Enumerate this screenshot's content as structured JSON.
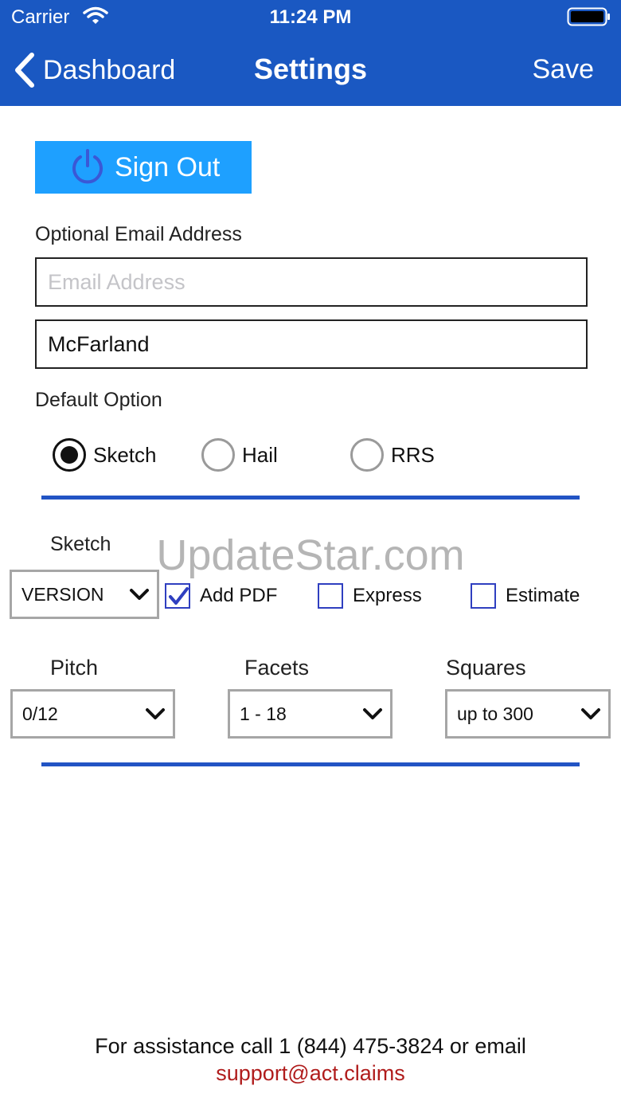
{
  "status_bar": {
    "carrier": "Carrier",
    "time": "11:24 PM"
  },
  "nav": {
    "back_label": "Dashboard",
    "title": "Settings",
    "save_label": "Save"
  },
  "sign_out": {
    "label": "Sign Out",
    "icon": "power-icon"
  },
  "email": {
    "label": "Optional Email Address",
    "placeholder": "Email Address",
    "value": ""
  },
  "name_field": {
    "value": "McFarland"
  },
  "default_option": {
    "label": "Default Option",
    "options": [
      "Sketch",
      "Hail",
      "RRS"
    ],
    "selected": "Sketch"
  },
  "sketch": {
    "label": "Sketch",
    "version_value": "VERSION",
    "checkboxes": [
      {
        "label": "Add PDF",
        "checked": true
      },
      {
        "label": "Express",
        "checked": false
      },
      {
        "label": "Estimate",
        "checked": false
      }
    ]
  },
  "dropdowns": {
    "pitch": {
      "label": "Pitch",
      "value": "0/12"
    },
    "facets": {
      "label": "Facets",
      "value": "1 - 18"
    },
    "squares": {
      "label": "Squares",
      "value": "up to 300"
    }
  },
  "watermark": "UpdateStar.com",
  "footer": {
    "text": "For assistance call 1 (844) 475-3824 or email",
    "email": "support@act.claims"
  },
  "colors": {
    "header": "#1a58c2",
    "sign_out_button": "#1ea0ff",
    "divider": "#2254c4",
    "checkbox": "#2f3fc0",
    "email_link": "#b01c1c"
  }
}
